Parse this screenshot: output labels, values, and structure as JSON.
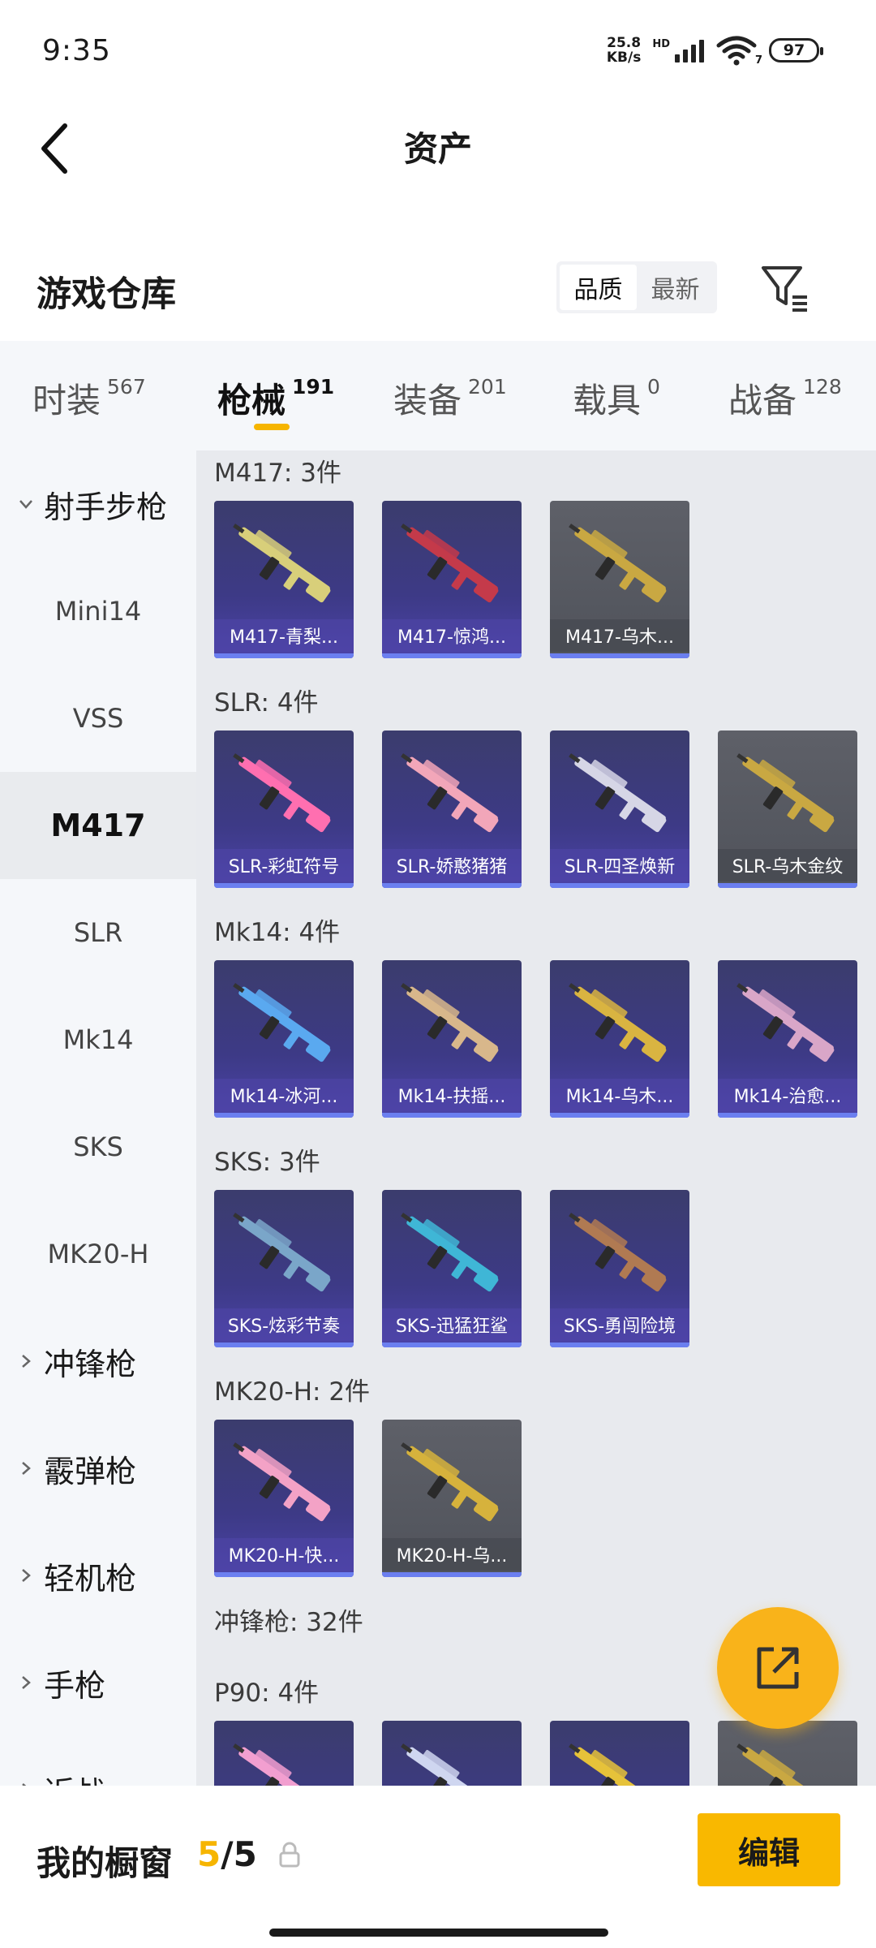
{
  "status_bar": {
    "time": "9:35",
    "net_speed_value": "25.8",
    "net_speed_unit": "KB/s",
    "hd_label": "HD",
    "wifi_sub": "7",
    "battery": "97"
  },
  "header": {
    "title": "资产"
  },
  "warehouse": {
    "title": "游戏仓库",
    "sort_options": [
      "品质",
      "最新"
    ],
    "active_sort": "品质"
  },
  "tabs": [
    {
      "label": "时装",
      "count": "567"
    },
    {
      "label": "枪械",
      "count": "191"
    },
    {
      "label": "装备",
      "count": "201"
    },
    {
      "label": "载具",
      "count": "0"
    },
    {
      "label": "战备",
      "count": "128"
    }
  ],
  "active_tab": "枪械",
  "sidebar": {
    "items": [
      {
        "label": "射手步枪",
        "type": "group-open"
      },
      {
        "label": "Mini14",
        "type": "item"
      },
      {
        "label": "VSS",
        "type": "item"
      },
      {
        "label": "M417",
        "type": "item-active"
      },
      {
        "label": "SLR",
        "type": "item"
      },
      {
        "label": "Mk14",
        "type": "item"
      },
      {
        "label": "SKS",
        "type": "item"
      },
      {
        "label": "MK20-H",
        "type": "item"
      },
      {
        "label": "冲锋枪",
        "type": "group"
      },
      {
        "label": "霰弹枪",
        "type": "group"
      },
      {
        "label": "轻机枪",
        "type": "group"
      },
      {
        "label": "手枪",
        "type": "group"
      },
      {
        "label": "近战",
        "type": "group"
      }
    ]
  },
  "groups": [
    {
      "title": "M417: 3件",
      "items": [
        {
          "label": "M417-青梨...",
          "rarity": "purple",
          "color": "#d8cf7a"
        },
        {
          "label": "M417-惊鸿...",
          "rarity": "purple",
          "color": "#c43a4a"
        },
        {
          "label": "M417-乌木...",
          "rarity": "gray",
          "color": "#c9a842"
        }
      ]
    },
    {
      "title": "SLR: 4件",
      "items": [
        {
          "label": "SLR-彩虹符号",
          "rarity": "purple",
          "color": "#ff6fb0"
        },
        {
          "label": "SLR-娇憨猪猪",
          "rarity": "purple",
          "color": "#f2a6b9"
        },
        {
          "label": "SLR-四圣焕新",
          "rarity": "purple",
          "color": "#d6d6e6"
        },
        {
          "label": "SLR-乌木金纹",
          "rarity": "gray",
          "color": "#c9a842"
        }
      ]
    },
    {
      "title": "Mk14: 4件",
      "items": [
        {
          "label": "Mk14-冰河...",
          "rarity": "purple",
          "color": "#5aa9f0"
        },
        {
          "label": "Mk14-扶摇...",
          "rarity": "purple",
          "color": "#d8b78b"
        },
        {
          "label": "Mk14-乌木...",
          "rarity": "purple",
          "color": "#d9b441"
        },
        {
          "label": "Mk14-治愈...",
          "rarity": "purple",
          "color": "#d9a6c8"
        }
      ]
    },
    {
      "title": "SKS: 3件",
      "items": [
        {
          "label": "SKS-炫彩节奏",
          "rarity": "purple",
          "color": "#7aa6c9"
        },
        {
          "label": "SKS-迅猛狂鲨",
          "rarity": "purple",
          "color": "#3fb6d6"
        },
        {
          "label": "SKS-勇闯险境",
          "rarity": "purple",
          "color": "#b07a52"
        }
      ]
    },
    {
      "title": "MK20-H: 2件",
      "items": [
        {
          "label": "MK20-H-快...",
          "rarity": "purple",
          "color": "#f3a2c6"
        },
        {
          "label": "MK20-H-乌...",
          "rarity": "gray",
          "color": "#d6b23c"
        }
      ]
    },
    {
      "title": "冲锋枪: 32件",
      "items": []
    },
    {
      "title": "P90: 4件",
      "items": [
        {
          "label": "",
          "rarity": "purple",
          "color": "#f29fd0"
        },
        {
          "label": "",
          "rarity": "purple",
          "color": "#cfd6f0"
        },
        {
          "label": "",
          "rarity": "purple",
          "color": "#e6c23a"
        },
        {
          "label": "",
          "rarity": "gray",
          "color": "#c9a842"
        }
      ]
    }
  ],
  "bottom_bar": {
    "showcase_label": "我的橱窗",
    "showcase_current": "5",
    "showcase_sep": "/",
    "showcase_total": "5",
    "edit_label": "编辑"
  },
  "colors": {
    "accent": "#f9b800",
    "rare_purple": "#4b43a8",
    "common_gray": "#50535b"
  }
}
